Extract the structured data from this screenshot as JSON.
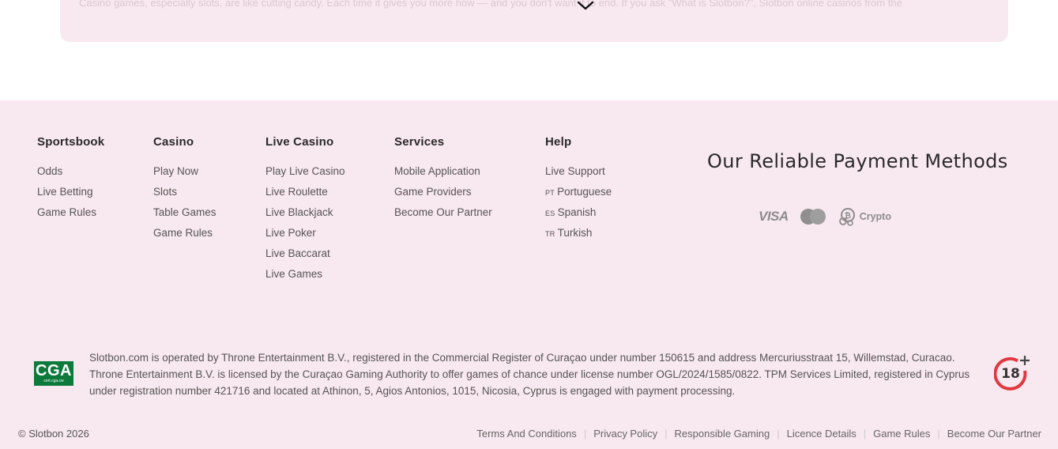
{
  "seo": {
    "line1": "Casino games, especially slots, are like cutting candy. Each time it gives you more how — and you don't want it to end. If you ask \"What is Slotbon?\", Slotbon online casinos from the",
    "line2": "",
    "expand_icon": "chevron-down-icon"
  },
  "footer": {
    "columns": [
      {
        "title": "Sportsbook",
        "items": [
          "Odds",
          "Live Betting",
          "Game Rules"
        ]
      },
      {
        "title": "Casino",
        "items": [
          "Play Now",
          "Slots",
          "Table Games",
          "Game Rules"
        ]
      },
      {
        "title": "Live Casino",
        "items": [
          "Play Live Casino",
          "Live Roulette",
          "Live Blackjack",
          "Live Poker",
          "Live Baccarat",
          "Live Games"
        ]
      },
      {
        "title": "Services",
        "items": [
          "Mobile Application",
          "Game Providers",
          "Become Our Partner"
        ]
      },
      {
        "title": "Help",
        "items": [
          {
            "code": "",
            "label": "Live Support"
          },
          {
            "code": "PT",
            "label": "Portuguese"
          },
          {
            "code": "ES",
            "label": "Spanish"
          },
          {
            "code": "TR",
            "label": "Turkish"
          }
        ]
      }
    ],
    "payment": {
      "title": "Our Reliable Payment Methods",
      "visa": "VISA",
      "crypto": "Crypto"
    },
    "license": {
      "cga_big": "CGA",
      "cga_small": "cert.cga.cw",
      "text": "Slotbon.com is operated by Throne Entertainment B.V., registered in the Commercial Register of Curaçao under number 150615 and address Mercuriusstraat 15, Willemstad, Curacao. Throne Entertainment B.V. is licensed by the Curaçao Gaming Authority to offer games of chance under license number OGL/2024/1585/0822. TPM Services Limited, registered in Cyprus under registration number 421716 and located at Athinon, 5, Agios Antonios, 1015, Nicosia, Cyprus is engaged with payment processing.",
      "age": "18"
    },
    "copyright": "© Slotbon 2026",
    "bottom_links": [
      "Terms And Conditions",
      "Privacy Policy",
      "Responsible Gaming",
      "Licence Details",
      "Game Rules",
      "Become Our Partner"
    ],
    "colors": {
      "background": "#f8e8ef",
      "age_red": "#e0383e",
      "cga_green": "#0c7a3a"
    }
  }
}
